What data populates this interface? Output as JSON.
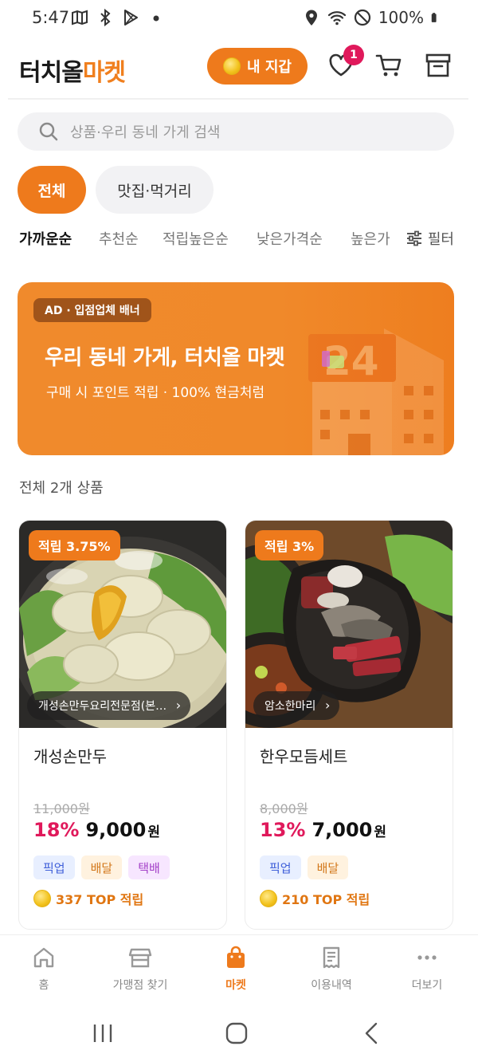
{
  "status_bar": {
    "time": "5:47",
    "battery": "100%",
    "left_icons": [
      "map-icon",
      "bluetooth-icon",
      "play-store-icon",
      "dot-icon"
    ],
    "right_icons": [
      "location-icon",
      "wifi-icon",
      "do-not-disturb-icon",
      "battery-icon"
    ]
  },
  "header": {
    "logo_part1": "터치올",
    "logo_part2": "마켓",
    "wallet_label": "내 지갑",
    "wishlist_badge": "1",
    "icons": [
      "heart-icon",
      "cart-icon",
      "archive-icon"
    ]
  },
  "search": {
    "placeholder": "상품·우리 동네 가게 검색"
  },
  "categories": [
    {
      "label": "전체",
      "active": true
    },
    {
      "label": "맛집·먹거리",
      "active": false
    }
  ],
  "sort": {
    "options": [
      "가까운순",
      "추천순",
      "적립높은순",
      "낮은가격순",
      "높은가"
    ],
    "active_index": 0,
    "filter_label": "필터"
  },
  "banner": {
    "ad_label": "AD · 입점업체 배너",
    "title": "우리 동네 가게, 터치올 마켓",
    "subtitle": "구매 시 포인트 적립 · 100% 현금처럼",
    "art_sign": "24"
  },
  "product_count_label": "전체 2개 상품",
  "products": [
    {
      "reward_tag": "적립 3.75%",
      "store": "개성손만두요리전문점(본…",
      "name": "개성손만두",
      "original_price": "11,000원",
      "discount": "18%",
      "price": "9,000",
      "currency": "원",
      "tags": [
        "픽업",
        "배달",
        "택배"
      ],
      "points": "337 TOP 적립"
    },
    {
      "reward_tag": "적립 3%",
      "store": "암소한마리",
      "name": "한우모듬세트",
      "original_price": "8,000원",
      "discount": "13%",
      "price": "7,000",
      "currency": "원",
      "tags": [
        "픽업",
        "배달"
      ],
      "points": "210 TOP 적립"
    }
  ],
  "bottom_nav": [
    {
      "label": "홈",
      "icon": "home-icon",
      "active": false
    },
    {
      "label": "가맹점 찾기",
      "icon": "store-icon",
      "active": false
    },
    {
      "label": "마켓",
      "icon": "shopping-bag-icon",
      "active": true
    },
    {
      "label": "이용내역",
      "icon": "receipt-icon",
      "active": false
    },
    {
      "label": "더보기",
      "icon": "more-icon",
      "active": false
    }
  ],
  "colors": {
    "accent": "#ee7a1c",
    "discount": "#e0195b",
    "badge": "#e0195b"
  }
}
